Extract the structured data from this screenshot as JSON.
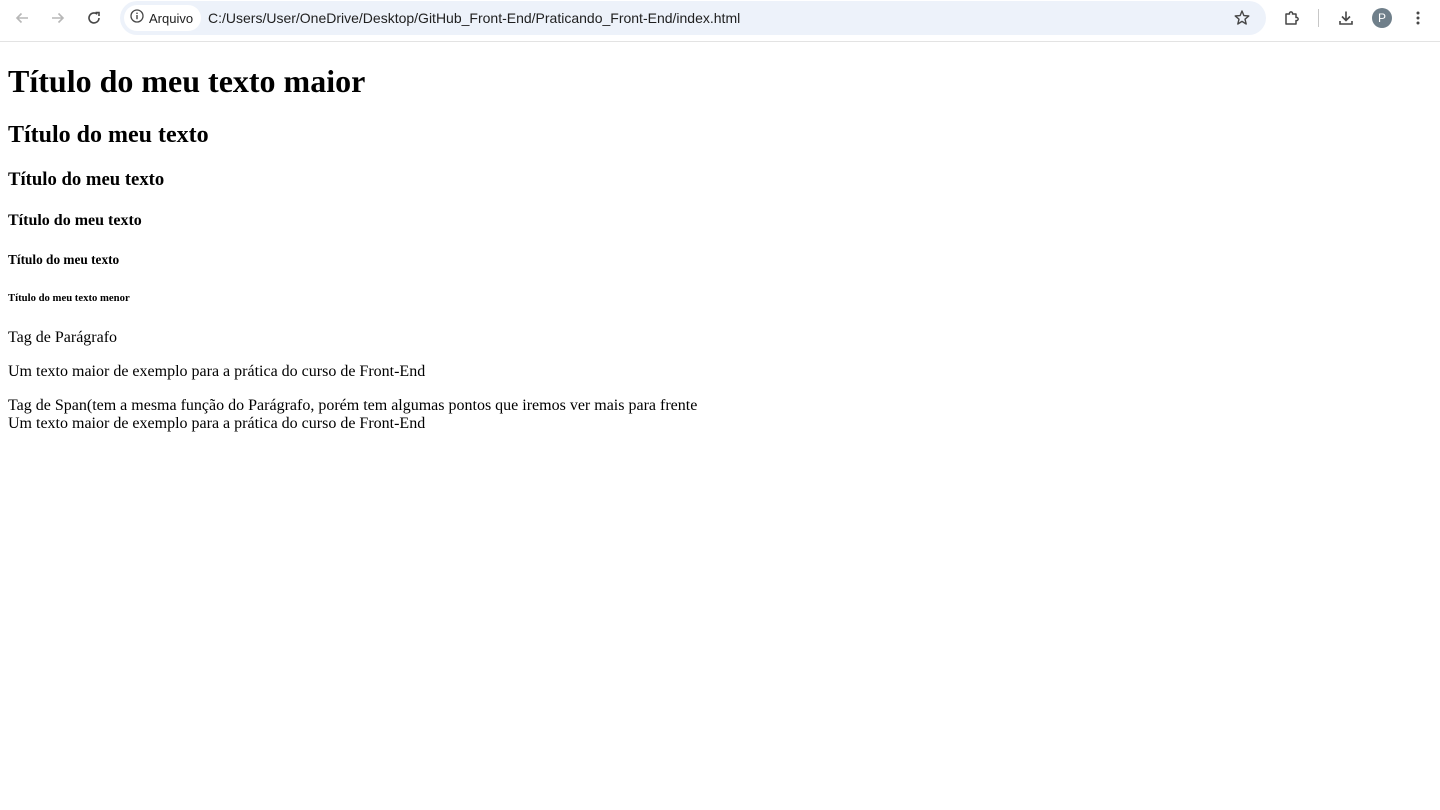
{
  "browser": {
    "security_chip_label": "Arquivo",
    "url": "C:/Users/User/OneDrive/Desktop/GitHub_Front-End/Praticando_Front-End/index.html",
    "profile_initial": "P",
    "icons": {
      "back": "arrow-left-icon",
      "forward": "arrow-right-icon",
      "reload": "reload-icon",
      "info": "info-icon",
      "bookmark": "star-icon",
      "extensions": "puzzle-icon",
      "downloads": "download-icon",
      "menu": "kebab-menu-icon"
    },
    "colors": {
      "omnibox_bg": "#edf2fa",
      "disabled_icon": "#b7b7b7",
      "icon": "#474747",
      "avatar_bg": "#6f7f8a"
    }
  },
  "page": {
    "h1": "Título do meu texto maior",
    "h2": "Título do meu texto",
    "h3": "Título do meu texto",
    "h4": "Título do meu texto",
    "h5": "Título do meu texto",
    "h6": "Título do meu texto menor",
    "paragraphs": [
      "Tag de Parágrafo",
      "Um texto maior de exemplo para a prática do curso de Front-End"
    ],
    "spans": [
      "Tag de Span(tem a mesma função do Parágrafo, porém tem algumas pontos que iremos ver mais para frente",
      "Um texto maior de exemplo para a prática do curso de Front-End"
    ]
  }
}
